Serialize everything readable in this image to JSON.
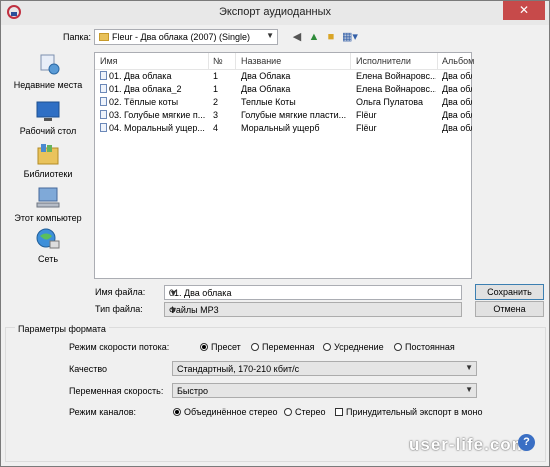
{
  "window": {
    "title": "Экспорт аудиоданных",
    "close": "✕"
  },
  "toolbar": {
    "folder_label": "Папка:",
    "folder_value": "Fleur - Два облака (2007) (Single)",
    "back_icon": "back-icon",
    "up_icon": "up-folder-icon",
    "new_folder_icon": "new-folder-icon",
    "view_icon": "view-menu-icon"
  },
  "places": [
    {
      "label": "Недавние места",
      "icon": "recent-places-icon"
    },
    {
      "label": "Рабочий стол",
      "icon": "desktop-icon"
    },
    {
      "label": "Библиотеки",
      "icon": "libraries-icon"
    },
    {
      "label": "Этот компьютер",
      "icon": "computer-icon"
    },
    {
      "label": "Сеть",
      "icon": "network-icon"
    }
  ],
  "filelist": {
    "columns": [
      "Имя",
      "№",
      "Название",
      "Исполнители",
      "Альбом"
    ],
    "rows": [
      {
        "name": "01. Два облака",
        "num": "1",
        "title": "Два Облака",
        "artist": "Елена Войнаровс...",
        "album": "Два облака (Single)"
      },
      {
        "name": "01. Два облака_2",
        "num": "1",
        "title": "Два Облака",
        "artist": "Елена Войнаровс...",
        "album": "Два облака (Single)"
      },
      {
        "name": "02. Тёплые коты",
        "num": "2",
        "title": "Теплые Коты",
        "artist": "Ольга Пулатова",
        "album": "Два облака (Single)"
      },
      {
        "name": "03. Голубые мягкие п...",
        "num": "3",
        "title": "Голубые мягкие пласти...",
        "artist": "Flёur",
        "album": "Два облака (Single)"
      },
      {
        "name": "04. Моральный ущер...",
        "num": "4",
        "title": "Моральный ущерб",
        "artist": "Flёur",
        "album": "Два облака (Single)"
      }
    ]
  },
  "filename": {
    "label": "Имя файла:",
    "value": "01. Два облака"
  },
  "filetype": {
    "label": "Тип файла:",
    "value": "Файлы MP3"
  },
  "buttons": {
    "save": "Сохранить",
    "cancel": "Отмена"
  },
  "format": {
    "group_title": "Параметры формата",
    "bitrate_mode_label": "Режим скорости потока:",
    "bitrate_modes": [
      {
        "label": "Пресет",
        "selected": true
      },
      {
        "label": "Переменная",
        "selected": false
      },
      {
        "label": "Усреднение",
        "selected": false
      },
      {
        "label": "Постоянная",
        "selected": false
      }
    ],
    "quality_label": "Качество",
    "quality_value": "Стандартный, 170-210 кбит/с",
    "variable_speed_label": "Переменная скорость:",
    "variable_speed_value": "Быстро",
    "channel_mode_label": "Режим каналов:",
    "channel_modes": [
      {
        "label": "Объединённое стерео",
        "selected": true
      },
      {
        "label": "Стерео",
        "selected": false
      }
    ],
    "force_mono_label": "Принудительный экспорт в моно",
    "force_mono_checked": false
  },
  "help": "?",
  "watermark": "user-life.com"
}
